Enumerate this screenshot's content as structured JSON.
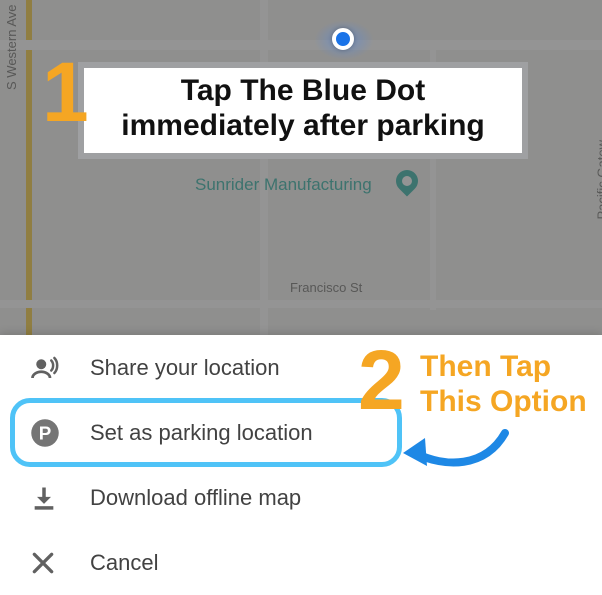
{
  "map": {
    "street_west": "S Western Ave",
    "street_east": "Pacific Gatew",
    "street_south": "Francisco St",
    "poi_label": "Sunrider Manufacturing"
  },
  "callout1": {
    "number": "1",
    "line1": "Tap The Blue Dot",
    "line2": "immediately after parking"
  },
  "callout2": {
    "number": "2",
    "line1": "Then Tap",
    "line2": "This Option"
  },
  "sheet": {
    "items": [
      {
        "label": "Share your location"
      },
      {
        "label": "Set as parking location"
      },
      {
        "label": "Download offline map"
      },
      {
        "label": "Cancel"
      }
    ]
  }
}
